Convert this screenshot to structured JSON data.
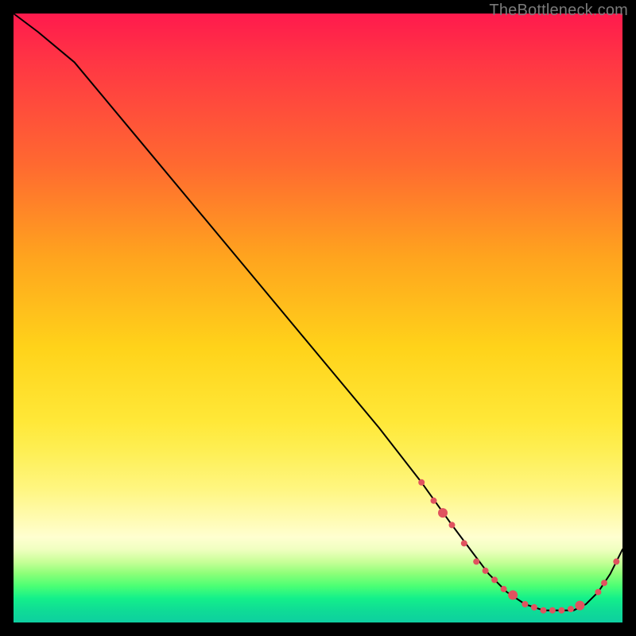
{
  "watermark": "TheBottleneck.com",
  "chart_data": {
    "type": "line",
    "title": "",
    "xlabel": "",
    "ylabel": "",
    "xlim": [
      0,
      100
    ],
    "ylim": [
      0,
      100
    ],
    "grid": false,
    "legend": false,
    "series": [
      {
        "name": "bottleneck-curve",
        "x": [
          0,
          4,
          10,
          20,
          30,
          40,
          50,
          60,
          67,
          72,
          75,
          78,
          81,
          84,
          87,
          90,
          92,
          94,
          96,
          98,
          100
        ],
        "y": [
          100,
          97,
          92,
          80,
          68,
          56,
          44,
          32,
          23,
          16,
          12,
          8,
          5,
          3,
          2,
          2,
          2,
          3,
          5,
          8,
          12
        ]
      }
    ],
    "markers": [
      {
        "x": 67,
        "y": 23,
        "r": 4
      },
      {
        "x": 69,
        "y": 20,
        "r": 4
      },
      {
        "x": 70.5,
        "y": 18,
        "r": 6
      },
      {
        "x": 72,
        "y": 16,
        "r": 4
      },
      {
        "x": 74,
        "y": 13,
        "r": 4
      },
      {
        "x": 76,
        "y": 10,
        "r": 4
      },
      {
        "x": 77.5,
        "y": 8.5,
        "r": 4
      },
      {
        "x": 79,
        "y": 7,
        "r": 4
      },
      {
        "x": 80.5,
        "y": 5.5,
        "r": 4
      },
      {
        "x": 82,
        "y": 4.5,
        "r": 6
      },
      {
        "x": 84,
        "y": 3,
        "r": 4
      },
      {
        "x": 85.5,
        "y": 2.5,
        "r": 4
      },
      {
        "x": 87,
        "y": 2,
        "r": 4
      },
      {
        "x": 88.5,
        "y": 2,
        "r": 4
      },
      {
        "x": 90,
        "y": 2,
        "r": 4
      },
      {
        "x": 91.5,
        "y": 2.2,
        "r": 4
      },
      {
        "x": 93,
        "y": 2.8,
        "r": 6
      },
      {
        "x": 96,
        "y": 5,
        "r": 4
      },
      {
        "x": 97,
        "y": 6.5,
        "r": 4
      },
      {
        "x": 99,
        "y": 10,
        "r": 4
      }
    ],
    "colors": {
      "curve": "#000000",
      "markers": "#e0535f",
      "gradient_top": "#ff1a4d",
      "gradient_mid": "#ffe838",
      "gradient_bottom": "#0ecfa0"
    }
  }
}
